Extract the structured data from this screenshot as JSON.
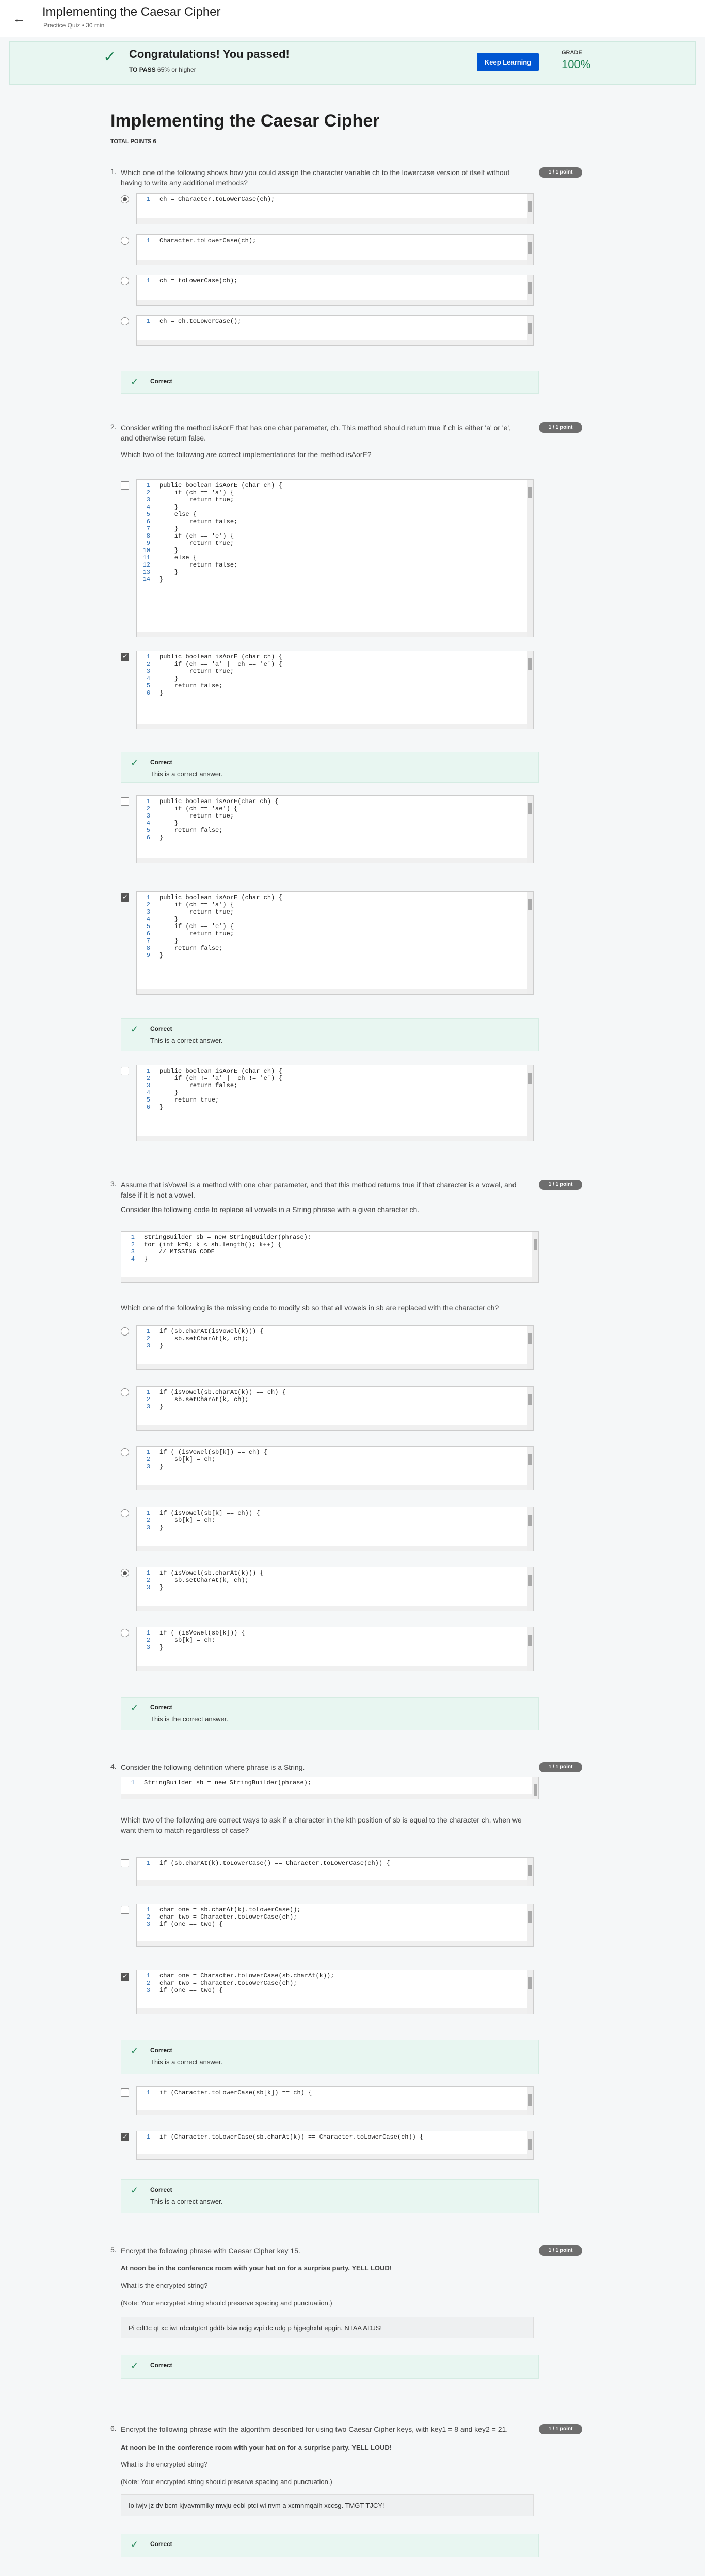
{
  "header": {
    "title": "Implementing the Caesar Cipher",
    "subtitle": "Practice Quiz • 30 min"
  },
  "banner": {
    "title": "Congratulations! You passed!",
    "to_pass_label": "TO PASS",
    "to_pass_value": "65% or higher",
    "button": "Keep Learning",
    "grade_label": "GRADE",
    "grade_value": "100%"
  },
  "page": {
    "title": "Implementing the Caesar Cipher",
    "total_points": "TOTAL POINTS 6"
  },
  "q1": {
    "num": "1.",
    "text": "Which one of the following shows how you could assign the character variable ch to the lowercase version of itself without having to write any additional methods?",
    "points": "1 / 1 point",
    "options": [
      [
        "ch = Character.toLowerCase(ch);"
      ],
      [
        "Character.toLowerCase(ch);"
      ],
      [
        "ch = toLowerCase(ch);"
      ],
      [
        "ch = ch.toLowerCase();"
      ]
    ],
    "fb": "Correct"
  },
  "q2": {
    "num": "2.",
    "text1": "Consider writing the method isAorE that has one char parameter, ch. This method should return true if ch is either 'a' or 'e', and otherwise return false.",
    "text2": "Which two of the following are correct implementations for the method isAorE?",
    "points": "1 / 1 point",
    "opt1": [
      "public boolean isAorE (char ch) {",
      "    if (ch == 'a') {",
      "        return true;",
      "    }",
      "    else {",
      "        return false;",
      "    }",
      "    if (ch == 'e') {",
      "        return true;",
      "    }",
      "    else {",
      "        return false;",
      "    }",
      "}"
    ],
    "opt2": [
      "public boolean isAorE (char ch) {",
      "    if (ch == 'a' || ch == 'e') {",
      "        return true;",
      "    }",
      "    return false;",
      "}"
    ],
    "opt3": [
      "public boolean isAorE(char ch) {",
      "    if (ch == 'ae') {",
      "        return true;",
      "    }",
      "    return false;",
      "}"
    ],
    "opt4": [
      "public boolean isAorE (char ch) {",
      "    if (ch == 'a') {",
      "        return true;",
      "    }",
      "    if (ch == 'e') {",
      "        return true;",
      "    }",
      "    return false;",
      "}"
    ],
    "opt5": [
      "public boolean isAorE (char ch) {",
      "    if (ch != 'a' || ch != 'e') {",
      "        return false;",
      "    }",
      "    return true;",
      "}"
    ],
    "fb_title": "Correct",
    "fb_msg": "This is a correct answer."
  },
  "q3": {
    "num": "3.",
    "text1": "Assume that isVowel is a method with one char parameter, and that this method returns true if that character is a vowel, and false if it is not a vowel.",
    "text2": "Consider the following code to replace all vowels in a String phrase with a given character ch.",
    "text3": "Which one of the following is the missing code to modify sb so that all vowels in sb are replaced with the character ch?",
    "points": "1 / 1 point",
    "given": [
      "StringBuilder sb = new StringBuilder(phrase);",
      "for (int k=0; k < sb.length(); k++) {",
      "    // MISSING CODE",
      "}"
    ],
    "opts": [
      [
        "if (sb.charAt(isVowel(k))) {",
        "    sb.setCharAt(k, ch);",
        "}"
      ],
      [
        "if (isVowel(sb.charAt(k)) == ch) {",
        "    sb.setCharAt(k, ch);",
        "}"
      ],
      [
        "if ( (isVowel(sb[k]) == ch) {",
        "    sb[k] = ch;",
        "}"
      ],
      [
        "if (isVowel(sb[k] == ch)) {",
        "    sb[k] = ch;",
        "}"
      ],
      [
        "if (isVowel(sb.charAt(k))) {",
        "    sb.setCharAt(k, ch);",
        "}"
      ],
      [
        "if ( (isVowel(sb[k])) {",
        "    sb[k] = ch;",
        "}"
      ]
    ],
    "fb_title": "Correct",
    "fb_msg": "This is the correct answer."
  },
  "q4": {
    "num": "4.",
    "text1": "Consider the following definition where phrase is a String.",
    "text2": "Which two of the following are correct ways to ask if a character in the kth position of sb is equal to the character ch, when we want them to match regardless of case?",
    "points": "1 / 1 point",
    "given": [
      "StringBuilder sb = new StringBuilder(phrase);"
    ],
    "opts": [
      [
        "if (sb.charAt(k).toLowerCase() == Character.toLowerCase(ch)) {"
      ],
      [
        "char one = sb.charAt(k).toLowerCase();",
        "char two = Character.toLowerCase(ch);",
        "if (one == two) {"
      ],
      [
        "char one = Character.toLowerCase(sb.charAt(k));",
        "char two = Character.toLowerCase(ch);",
        "if (one == two) {"
      ],
      [
        "if (Character.toLowerCase(sb[k]) == ch) {"
      ],
      [
        "if (Character.toLowerCase(sb.charAt(k)) == Character.toLowerCase(ch)) {"
      ]
    ],
    "fb_title": "Correct",
    "fb_msg": "This is a correct answer."
  },
  "q5": {
    "num": "5.",
    "text1": "Encrypt the following phrase with Caesar Cipher key 15.",
    "phrase": "At noon be in the conference room with your hat on for a surprise party. YELL LOUD!",
    "q": "What is the encrypted string?",
    "note": "(Note: Your encrypted string should preserve spacing and punctuation.)",
    "answer": "Pi cdDc qt xc iwt rdcutgtcrt gddb lxiw ndjg wpi dc udg p hjgeghxht epgin. NTAA ADJS!",
    "points": "1 / 1 point",
    "fb": "Correct"
  },
  "q6": {
    "num": "6.",
    "text1": "Encrypt the following phrase with the algorithm described for using two Caesar Cipher keys, with key1 = 8 and key2 = 21.",
    "phrase": "At noon be in the conference room with your hat on for a surprise party. YELL LOUD!",
    "q": "What is the encrypted string?",
    "note": "(Note: Your encrypted string should preserve spacing and punctuation.)",
    "answer": "Io iwjv jz dv bcm kjvavmmiky mwju ecbl ptci wi nvm a xcmnmqaih xccsg. TMGT TJCY!",
    "points": "1 / 1 point",
    "fb": "Correct"
  }
}
